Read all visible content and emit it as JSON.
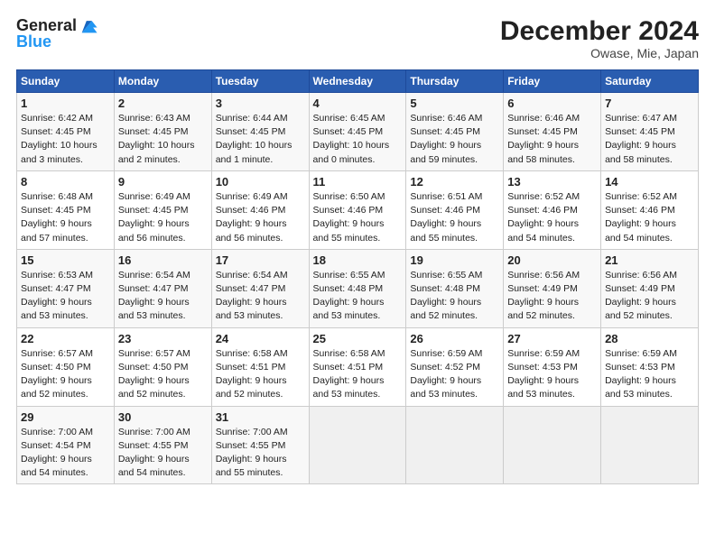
{
  "header": {
    "logo_text1": "General",
    "logo_text2": "Blue",
    "title": "December 2024",
    "subtitle": "Owase, Mie, Japan"
  },
  "weekdays": [
    "Sunday",
    "Monday",
    "Tuesday",
    "Wednesday",
    "Thursday",
    "Friday",
    "Saturday"
  ],
  "weeks": [
    [
      {
        "day": "1",
        "sunrise": "Sunrise: 6:42 AM",
        "sunset": "Sunset: 4:45 PM",
        "daylight": "Daylight: 10 hours and 3 minutes."
      },
      {
        "day": "2",
        "sunrise": "Sunrise: 6:43 AM",
        "sunset": "Sunset: 4:45 PM",
        "daylight": "Daylight: 10 hours and 2 minutes."
      },
      {
        "day": "3",
        "sunrise": "Sunrise: 6:44 AM",
        "sunset": "Sunset: 4:45 PM",
        "daylight": "Daylight: 10 hours and 1 minute."
      },
      {
        "day": "4",
        "sunrise": "Sunrise: 6:45 AM",
        "sunset": "Sunset: 4:45 PM",
        "daylight": "Daylight: 10 hours and 0 minutes."
      },
      {
        "day": "5",
        "sunrise": "Sunrise: 6:46 AM",
        "sunset": "Sunset: 4:45 PM",
        "daylight": "Daylight: 9 hours and 59 minutes."
      },
      {
        "day": "6",
        "sunrise": "Sunrise: 6:46 AM",
        "sunset": "Sunset: 4:45 PM",
        "daylight": "Daylight: 9 hours and 58 minutes."
      },
      {
        "day": "7",
        "sunrise": "Sunrise: 6:47 AM",
        "sunset": "Sunset: 4:45 PM",
        "daylight": "Daylight: 9 hours and 58 minutes."
      }
    ],
    [
      {
        "day": "8",
        "sunrise": "Sunrise: 6:48 AM",
        "sunset": "Sunset: 4:45 PM",
        "daylight": "Daylight: 9 hours and 57 minutes."
      },
      {
        "day": "9",
        "sunrise": "Sunrise: 6:49 AM",
        "sunset": "Sunset: 4:45 PM",
        "daylight": "Daylight: 9 hours and 56 minutes."
      },
      {
        "day": "10",
        "sunrise": "Sunrise: 6:49 AM",
        "sunset": "Sunset: 4:46 PM",
        "daylight": "Daylight: 9 hours and 56 minutes."
      },
      {
        "day": "11",
        "sunrise": "Sunrise: 6:50 AM",
        "sunset": "Sunset: 4:46 PM",
        "daylight": "Daylight: 9 hours and 55 minutes."
      },
      {
        "day": "12",
        "sunrise": "Sunrise: 6:51 AM",
        "sunset": "Sunset: 4:46 PM",
        "daylight": "Daylight: 9 hours and 55 minutes."
      },
      {
        "day": "13",
        "sunrise": "Sunrise: 6:52 AM",
        "sunset": "Sunset: 4:46 PM",
        "daylight": "Daylight: 9 hours and 54 minutes."
      },
      {
        "day": "14",
        "sunrise": "Sunrise: 6:52 AM",
        "sunset": "Sunset: 4:46 PM",
        "daylight": "Daylight: 9 hours and 54 minutes."
      }
    ],
    [
      {
        "day": "15",
        "sunrise": "Sunrise: 6:53 AM",
        "sunset": "Sunset: 4:47 PM",
        "daylight": "Daylight: 9 hours and 53 minutes."
      },
      {
        "day": "16",
        "sunrise": "Sunrise: 6:54 AM",
        "sunset": "Sunset: 4:47 PM",
        "daylight": "Daylight: 9 hours and 53 minutes."
      },
      {
        "day": "17",
        "sunrise": "Sunrise: 6:54 AM",
        "sunset": "Sunset: 4:47 PM",
        "daylight": "Daylight: 9 hours and 53 minutes."
      },
      {
        "day": "18",
        "sunrise": "Sunrise: 6:55 AM",
        "sunset": "Sunset: 4:48 PM",
        "daylight": "Daylight: 9 hours and 53 minutes."
      },
      {
        "day": "19",
        "sunrise": "Sunrise: 6:55 AM",
        "sunset": "Sunset: 4:48 PM",
        "daylight": "Daylight: 9 hours and 52 minutes."
      },
      {
        "day": "20",
        "sunrise": "Sunrise: 6:56 AM",
        "sunset": "Sunset: 4:49 PM",
        "daylight": "Daylight: 9 hours and 52 minutes."
      },
      {
        "day": "21",
        "sunrise": "Sunrise: 6:56 AM",
        "sunset": "Sunset: 4:49 PM",
        "daylight": "Daylight: 9 hours and 52 minutes."
      }
    ],
    [
      {
        "day": "22",
        "sunrise": "Sunrise: 6:57 AM",
        "sunset": "Sunset: 4:50 PM",
        "daylight": "Daylight: 9 hours and 52 minutes."
      },
      {
        "day": "23",
        "sunrise": "Sunrise: 6:57 AM",
        "sunset": "Sunset: 4:50 PM",
        "daylight": "Daylight: 9 hours and 52 minutes."
      },
      {
        "day": "24",
        "sunrise": "Sunrise: 6:58 AM",
        "sunset": "Sunset: 4:51 PM",
        "daylight": "Daylight: 9 hours and 52 minutes."
      },
      {
        "day": "25",
        "sunrise": "Sunrise: 6:58 AM",
        "sunset": "Sunset: 4:51 PM",
        "daylight": "Daylight: 9 hours and 53 minutes."
      },
      {
        "day": "26",
        "sunrise": "Sunrise: 6:59 AM",
        "sunset": "Sunset: 4:52 PM",
        "daylight": "Daylight: 9 hours and 53 minutes."
      },
      {
        "day": "27",
        "sunrise": "Sunrise: 6:59 AM",
        "sunset": "Sunset: 4:53 PM",
        "daylight": "Daylight: 9 hours and 53 minutes."
      },
      {
        "day": "28",
        "sunrise": "Sunrise: 6:59 AM",
        "sunset": "Sunset: 4:53 PM",
        "daylight": "Daylight: 9 hours and 53 minutes."
      }
    ],
    [
      {
        "day": "29",
        "sunrise": "Sunrise: 7:00 AM",
        "sunset": "Sunset: 4:54 PM",
        "daylight": "Daylight: 9 hours and 54 minutes."
      },
      {
        "day": "30",
        "sunrise": "Sunrise: 7:00 AM",
        "sunset": "Sunset: 4:55 PM",
        "daylight": "Daylight: 9 hours and 54 minutes."
      },
      {
        "day": "31",
        "sunrise": "Sunrise: 7:00 AM",
        "sunset": "Sunset: 4:55 PM",
        "daylight": "Daylight: 9 hours and 55 minutes."
      },
      null,
      null,
      null,
      null
    ]
  ]
}
